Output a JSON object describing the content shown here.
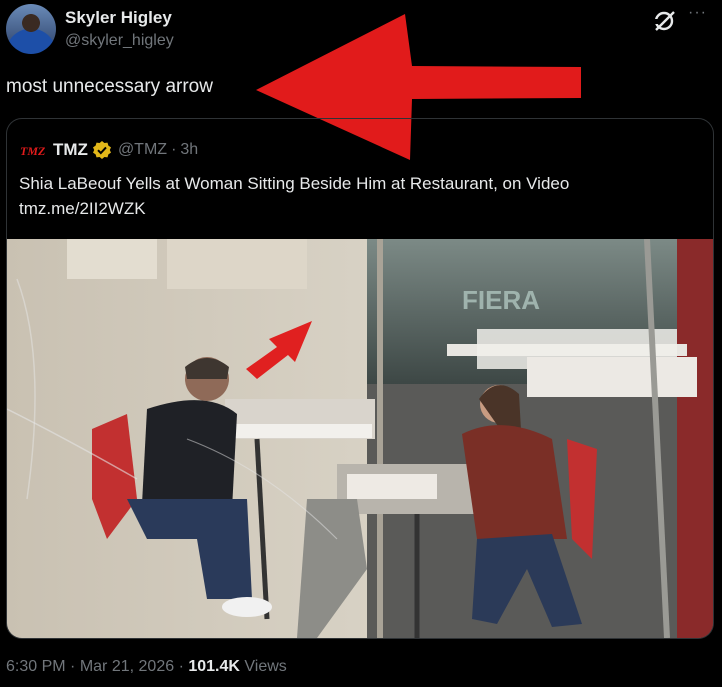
{
  "author": {
    "name": "Skyler Higley",
    "handle": "@skyler_higley"
  },
  "header": {
    "grok_icon": "grok-icon",
    "more_icon": "more-horizontal-icon",
    "more_label": "···"
  },
  "tweet": {
    "text": "most unnecessary arrow"
  },
  "quote": {
    "logo_text": "TMZ",
    "name": "TMZ",
    "verified_icon": "verified-badge-icon",
    "handle": "@TMZ",
    "separator": "·",
    "time": "3h",
    "title": "Shia LaBeouf Yells at Woman Sitting Beside Him at Restaurant, on Video",
    "link": "tmz.me/2II2WZK",
    "media": {
      "sign_text": "FIERA",
      "arrow_color": "#e02020"
    }
  },
  "footer": {
    "time": "6:30 PM",
    "sep1": "·",
    "date": "Mar 21, 2026",
    "sep2": "·",
    "views": "101.4K",
    "views_label": "Views"
  },
  "colors": {
    "background": "#000000",
    "text": "#e7e9ea",
    "muted": "#71767b",
    "border": "#2f3336",
    "arrow": "#e11b1b",
    "verified": "#e2b719"
  }
}
